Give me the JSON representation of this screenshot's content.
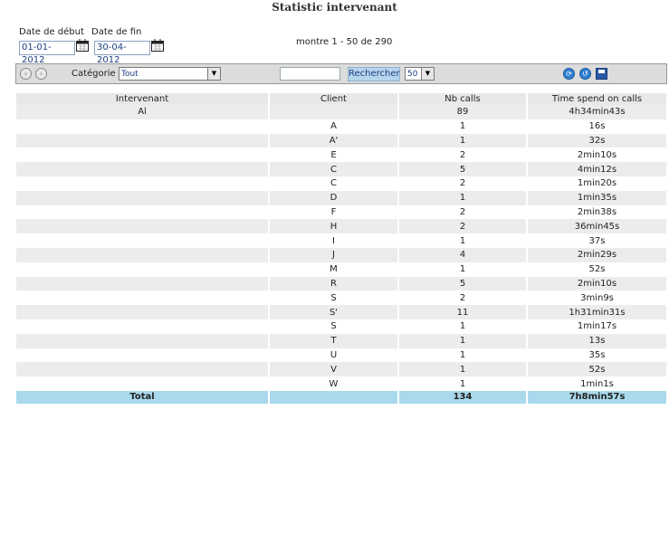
{
  "page": {
    "title": "Statistic intervenant"
  },
  "dates": {
    "start_label": "Date de début",
    "end_label": "Date de fin",
    "start_value": "01-01-2012",
    "end_value": "30-04-2012"
  },
  "range_text": "montre 1 - 50 de 290",
  "toolbar": {
    "category_label": "Catégorie",
    "category_value": "Tout",
    "search_value": "",
    "search_button": "Rechercher",
    "page_size": "50"
  },
  "table": {
    "headers": [
      "Intervenant",
      "Client",
      "Nb calls",
      "Time spend on calls"
    ],
    "rows": [
      {
        "intervenant": "Al",
        "client": "",
        "calls": "89",
        "time": "4h34min43s"
      },
      {
        "intervenant": "",
        "client": "A",
        "calls": "1",
        "time": "16s"
      },
      {
        "intervenant": "",
        "client": "A'",
        "calls": "1",
        "time": "32s"
      },
      {
        "intervenant": "",
        "client": "E",
        "calls": "2",
        "time": "2min10s"
      },
      {
        "intervenant": "",
        "client": "C",
        "calls": "5",
        "time": "4min12s"
      },
      {
        "intervenant": "",
        "client": "C",
        "calls": "2",
        "time": "1min20s"
      },
      {
        "intervenant": "",
        "client": "D",
        "calls": "1",
        "time": "1min35s"
      },
      {
        "intervenant": "",
        "client": "F",
        "calls": "2",
        "time": "2min38s"
      },
      {
        "intervenant": "",
        "client": "H",
        "calls": "2",
        "time": "36min45s"
      },
      {
        "intervenant": "",
        "client": "I",
        "calls": "1",
        "time": "37s"
      },
      {
        "intervenant": "",
        "client": "J",
        "calls": "4",
        "time": "2min29s"
      },
      {
        "intervenant": "",
        "client": "M",
        "calls": "1",
        "time": "52s"
      },
      {
        "intervenant": "",
        "client": "R",
        "calls": "5",
        "time": "2min10s"
      },
      {
        "intervenant": "",
        "client": "S",
        "calls": "2",
        "time": "3min9s"
      },
      {
        "intervenant": "",
        "client": "S'",
        "calls": "11",
        "time": "1h31min31s"
      },
      {
        "intervenant": "",
        "client": "S",
        "calls": "1",
        "time": "1min17s"
      },
      {
        "intervenant": "",
        "client": "T",
        "calls": "1",
        "time": "13s"
      },
      {
        "intervenant": "",
        "client": "U",
        "calls": "1",
        "time": "35s"
      },
      {
        "intervenant": "",
        "client": "V",
        "calls": "1",
        "time": "52s"
      },
      {
        "intervenant": "",
        "client": "W",
        "calls": "1",
        "time": "1min1s"
      }
    ],
    "total": {
      "label": "Total",
      "calls": "134",
      "time": "7h8min57s"
    }
  }
}
